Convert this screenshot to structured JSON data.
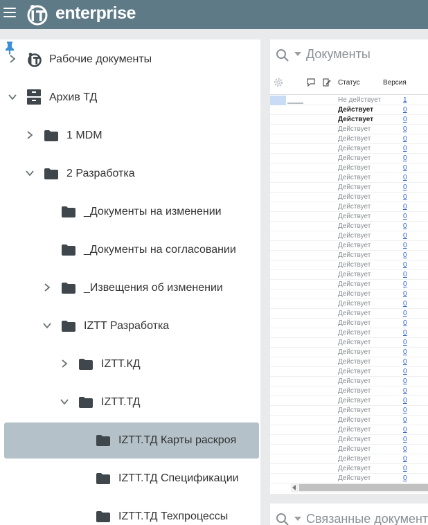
{
  "app": {
    "brand": "enterprise"
  },
  "tree": {
    "items": [
      {
        "label": "Рабочие документы",
        "level": 0,
        "chevron": "right",
        "icon": "logo-icon"
      },
      {
        "label": "Архив ТД",
        "level": 0,
        "chevron": "down",
        "icon": "cabinet-icon"
      },
      {
        "label": "1 MDM",
        "level": 1,
        "chevron": "right",
        "icon": "folder-icon"
      },
      {
        "label": "2 Разработка",
        "level": 1,
        "chevron": "down",
        "icon": "folder-icon"
      },
      {
        "label": "_Документы на изменении",
        "level": 2,
        "chevron": "",
        "icon": "folder-icon"
      },
      {
        "label": "_Документы на согласовании",
        "level": 2,
        "chevron": "",
        "icon": "folder-icon"
      },
      {
        "label": "_Извещения об изменении",
        "level": 2,
        "chevron": "right",
        "icon": "folder-icon"
      },
      {
        "label": "IZTT Разработка",
        "level": 2,
        "chevron": "down",
        "icon": "folder-icon"
      },
      {
        "label": "IZTT.КД",
        "level": 3,
        "chevron": "right",
        "icon": "folder-icon"
      },
      {
        "label": "IZTT.ТД",
        "level": 3,
        "chevron": "down",
        "icon": "folder-icon"
      },
      {
        "label": "IZTT.ТД Карты раскроя",
        "level": 4,
        "chevron": "",
        "icon": "folder-icon",
        "selected": true
      },
      {
        "label": "IZTT.ТД Спецификации",
        "level": 4,
        "chevron": "",
        "icon": "folder-icon"
      },
      {
        "label": "IZTT.ТД Техпроцессы",
        "level": 4,
        "chevron": "",
        "icon": "folder-icon"
      }
    ]
  },
  "documents": {
    "title": "Документы",
    "columns": {
      "status": "Статус",
      "version": "Версия"
    },
    "rows": [
      {
        "status": "Не действует",
        "version": "1",
        "bold": false
      },
      {
        "status": "Действует",
        "version": "0",
        "bold": true
      },
      {
        "status": "Действует",
        "version": "0",
        "bold": true
      },
      {
        "status": "Действует",
        "version": "0",
        "bold": false
      },
      {
        "status": "Действует",
        "version": "0",
        "bold": false
      },
      {
        "status": "Действует",
        "version": "0",
        "bold": false
      },
      {
        "status": "Действует",
        "version": "0",
        "bold": false
      },
      {
        "status": "Действует",
        "version": "0",
        "bold": false
      },
      {
        "status": "Действует",
        "version": "0",
        "bold": false
      },
      {
        "status": "Действует",
        "version": "0",
        "bold": false
      },
      {
        "status": "Действует",
        "version": "0",
        "bold": false
      },
      {
        "status": "Действует",
        "version": "0",
        "bold": false
      },
      {
        "status": "Действует",
        "version": "0",
        "bold": false
      },
      {
        "status": "Действует",
        "version": "0",
        "bold": false
      },
      {
        "status": "Действует",
        "version": "0",
        "bold": false
      },
      {
        "status": "Действует",
        "version": "0",
        "bold": false
      },
      {
        "status": "Действует",
        "version": "0",
        "bold": false
      },
      {
        "status": "Действует",
        "version": "0",
        "bold": false
      },
      {
        "status": "Действует",
        "version": "0",
        "bold": false
      },
      {
        "status": "Действует",
        "version": "0",
        "bold": false
      },
      {
        "status": "Действует",
        "version": "0",
        "bold": false
      },
      {
        "status": "Действует",
        "version": "0",
        "bold": false
      },
      {
        "status": "Действует",
        "version": "0",
        "bold": false
      },
      {
        "status": "Действует",
        "version": "0",
        "bold": false
      },
      {
        "status": "Действует",
        "version": "0",
        "bold": false
      },
      {
        "status": "Действует",
        "version": "0",
        "bold": false
      },
      {
        "status": "Действует",
        "version": "0",
        "bold": false
      },
      {
        "status": "Действует",
        "version": "0",
        "bold": false
      },
      {
        "status": "Действует",
        "version": "0",
        "bold": false
      },
      {
        "status": "Действует",
        "version": "0",
        "bold": false
      },
      {
        "status": "Действует",
        "version": "0",
        "bold": false
      },
      {
        "status": "Действует",
        "version": "0",
        "bold": false
      },
      {
        "status": "Действует",
        "version": "0",
        "bold": false
      },
      {
        "status": "Действует",
        "version": "0",
        "bold": false
      },
      {
        "status": "Действует",
        "version": "0",
        "bold": false
      },
      {
        "status": "Действует",
        "version": "0",
        "bold": false
      },
      {
        "status": "Действует",
        "version": "0",
        "bold": false
      },
      {
        "status": "Действует",
        "version": "0",
        "bold": false
      },
      {
        "status": "Действует",
        "version": "0",
        "bold": false
      },
      {
        "status": "Действует",
        "version": "0",
        "bold": false
      }
    ]
  },
  "related": {
    "title": "Связанные документы"
  }
}
